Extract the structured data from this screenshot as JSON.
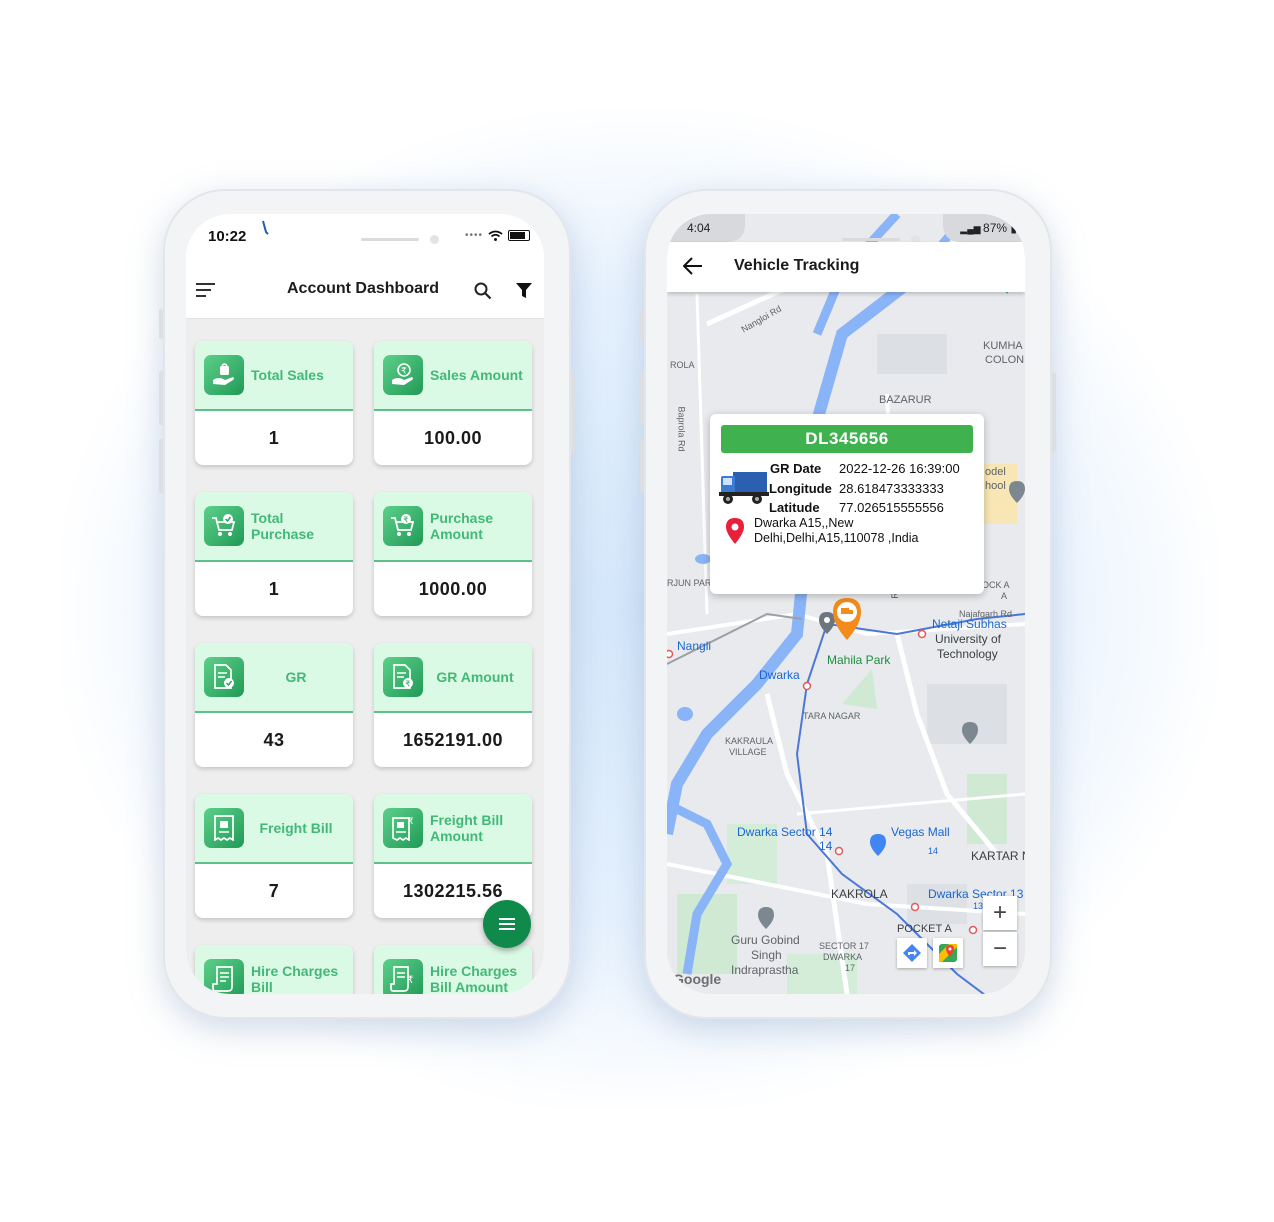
{
  "left_phone": {
    "status": {
      "time": "10:22"
    },
    "appbar": {
      "title": "Account Dashboard"
    },
    "cards": [
      {
        "label": "Total Sales",
        "value": "1",
        "icon": "hand-bag-icon"
      },
      {
        "label": "Sales Amount",
        "value": "100.00",
        "icon": "hand-rupee-icon"
      },
      {
        "label": "Total Purchase",
        "value": "1",
        "icon": "cart-check-icon"
      },
      {
        "label": "Purchase Amount",
        "value": "1000.00",
        "icon": "cart-rupee-icon"
      },
      {
        "label": "GR",
        "value": "43",
        "icon": "document-check-icon"
      },
      {
        "label": "GR Amount",
        "value": "1652191.00",
        "icon": "document-rupee-icon"
      },
      {
        "label": "Freight Bill",
        "value": "7",
        "icon": "receipt-box-icon"
      },
      {
        "label": "Freight Bill Amount",
        "value": "1302215.56",
        "icon": "receipt-rupee-icon"
      },
      {
        "label": "Hire Charges Bill",
        "value": "",
        "icon": "bill-icon"
      },
      {
        "label": "Hire Charges Bill Amount",
        "value": "",
        "icon": "bill-rupee-icon"
      }
    ],
    "colors": {
      "accent": "#43b877",
      "card_top": "#dbfae6",
      "fab": "#0f8a4a"
    }
  },
  "right_phone": {
    "status": {
      "time": "4:04",
      "battery": "87%"
    },
    "appbar": {
      "title": "Vehicle Tracking"
    },
    "popup": {
      "vehicle_no": "DL345656",
      "gr_date_label": "GR Date",
      "gr_date": "2022-12-26 16:39:00",
      "longitude_label": "Longitude",
      "longitude": "28.618473333333",
      "latitude_label": "Latitude",
      "latitude": "77.026515555556",
      "address": "Dwarka A15,,New Delhi,Delhi,A15,110078 ,India"
    },
    "map_labels": {
      "nangloi_rd": "Nangloi Rd",
      "baprola_rd": "Baprola Rd",
      "rola": "ROLA",
      "kumhar": "KUMHA",
      "colon": "COLON",
      "bazar": "BAZARUR",
      "model": "odel",
      "school": "hool",
      "arjun_park": "RJUN PARK",
      "block_a": "LOCK A",
      "a": "A",
      "rd": "Rd",
      "najafgarh_rd": "Najafgarh Rd",
      "netaji": "Netaji Subhas",
      "university": "University of",
      "technology": "Technology",
      "nangli": "Nangli",
      "mahila_park": "Mahila Park",
      "dwarka": "Dwarka",
      "tara_nagar": "TARA NAGAR",
      "kakraula": "KAKRAULA",
      "village": "VILLAGE",
      "dwarka_sector_14": "Dwarka Sector 14",
      "num_14": "14",
      "vegas_mall": "Vegas Mall",
      "num_14b": "14",
      "kartar": "KARTAR N",
      "kakrola": "KAKROLA",
      "dwarka_sector_13": "Dwarka Sector 13",
      "num_13": "13",
      "pocket_a": "POCKET A",
      "guru_gobind": "Guru Gobind",
      "singh": "Singh",
      "indraprastha": "Indraprastha",
      "sector_17": "SECTOR 17",
      "dwarka_small": "DWARKA",
      "num_17": "17",
      "google": "Google"
    },
    "zoom": {
      "plus": "+",
      "minus": "−"
    },
    "colors": {
      "plate": "#3fb24f",
      "route": "#4a78d9",
      "river": "#8ab4f8",
      "pin": "#e8203a"
    }
  }
}
